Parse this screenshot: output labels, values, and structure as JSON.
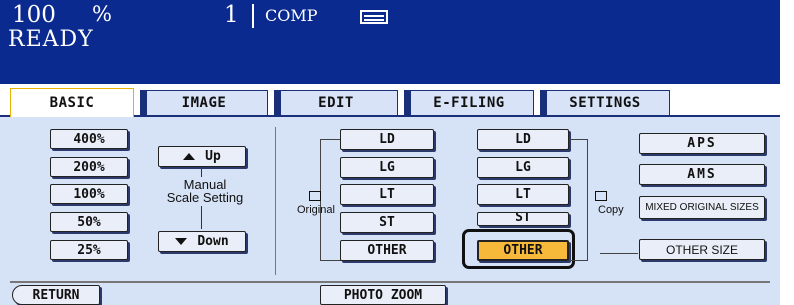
{
  "status": {
    "zoom_value": "100",
    "zoom_unit": "%",
    "copy_count": "1",
    "mode": "COMP",
    "state": "READY",
    "paper_icon": "paper-tray-icon"
  },
  "tabs": [
    {
      "label": "BASIC",
      "active": true
    },
    {
      "label": "IMAGE",
      "active": false
    },
    {
      "label": "EDIT",
      "active": false
    },
    {
      "label": "E-FILING",
      "active": false
    },
    {
      "label": "SETTINGS",
      "active": false
    }
  ],
  "zoom_presets": [
    "400%",
    "200%",
    "100%",
    "50%",
    "25%"
  ],
  "manual_scale": {
    "up_label": "Up",
    "down_label": "Down",
    "label_line1": "Manual",
    "label_line2": "Scale Setting"
  },
  "original": {
    "label": "Original",
    "sizes": [
      "LD",
      "LG",
      "LT",
      "ST",
      "OTHER"
    ]
  },
  "copy": {
    "label": "Copy",
    "sizes": [
      "LD",
      "LG",
      "LT",
      "ST",
      "OTHER"
    ],
    "selected": "OTHER"
  },
  "modes": {
    "aps": "APS",
    "ams": "AMS",
    "mixed": "MIXED ORIGINAL SIZES",
    "other_size": "OTHER SIZE"
  },
  "footer": {
    "return_label": "RETURN",
    "photo_zoom_label": "PHOTO ZOOM"
  },
  "colors": {
    "status_bg": "#0b2a8f",
    "panel_bg": "#d6e2f6",
    "selected": "#f7b93a"
  }
}
